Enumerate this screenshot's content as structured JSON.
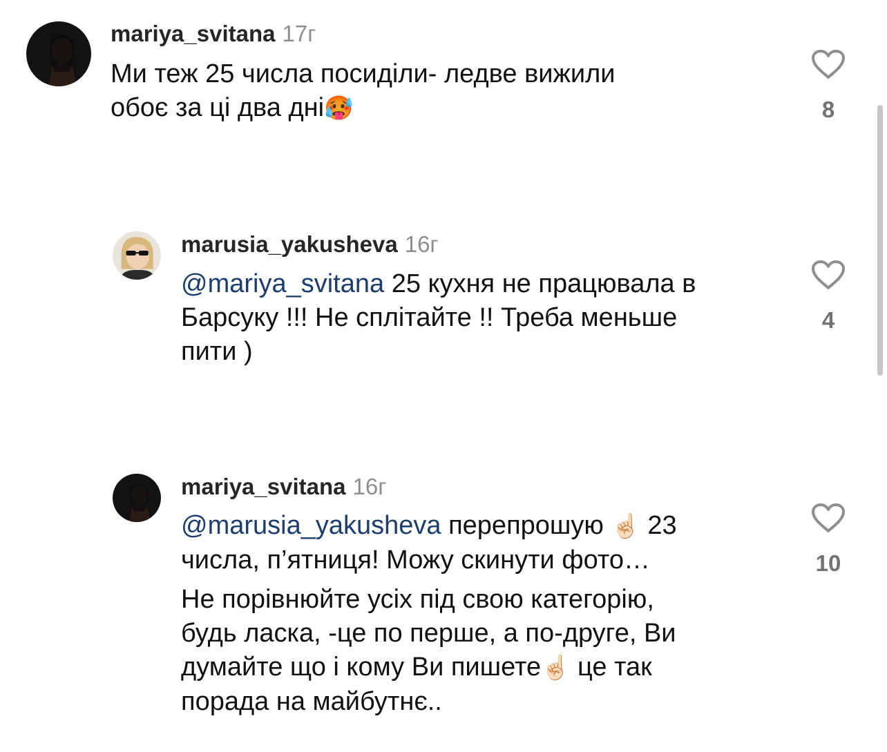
{
  "comments": [
    {
      "username": "mariya_svitana",
      "time": "17г",
      "lines": [
        "Ми теж 25 числа посиділи- ледве вижили",
        "обоє за ці два дні"
      ],
      "emoji": "🥵",
      "likes": "8"
    },
    {
      "username": "marusia_yakusheva",
      "time": "16г",
      "mention": "@mariya_svitana",
      "lines": [
        " 25 кухня не працювала в",
        "Барсуку !!! Не сплітайте !! Треба меньше",
        "пити )"
      ],
      "likes": "4"
    },
    {
      "username": "mariya_svitana",
      "time": "16г",
      "mention": "@marusia_yakusheva",
      "p1": {
        "line1_a": " перепрошую ",
        "emoji": "☝🏻",
        "line1_b": " 23",
        "line2": "числа, п’ятниця! Можу скинути фото…"
      },
      "p2": {
        "line1": "Не порівнюйте усіх під свою категорію,",
        "line2": "будь ласка, -це по перше, а по-друге, Ви",
        "line3_a": "думайте що і кому Ви пишете",
        "emoji": "☝🏻",
        "line3_b": " це так",
        "line4": "порада на майбутнє.."
      },
      "likes": "10"
    }
  ],
  "icons": {
    "like": "heart-outline-icon"
  },
  "colors": {
    "mention": "#1c3d6e",
    "username": "#262626",
    "time": "#8e8e8e",
    "like_count": "#737373"
  }
}
